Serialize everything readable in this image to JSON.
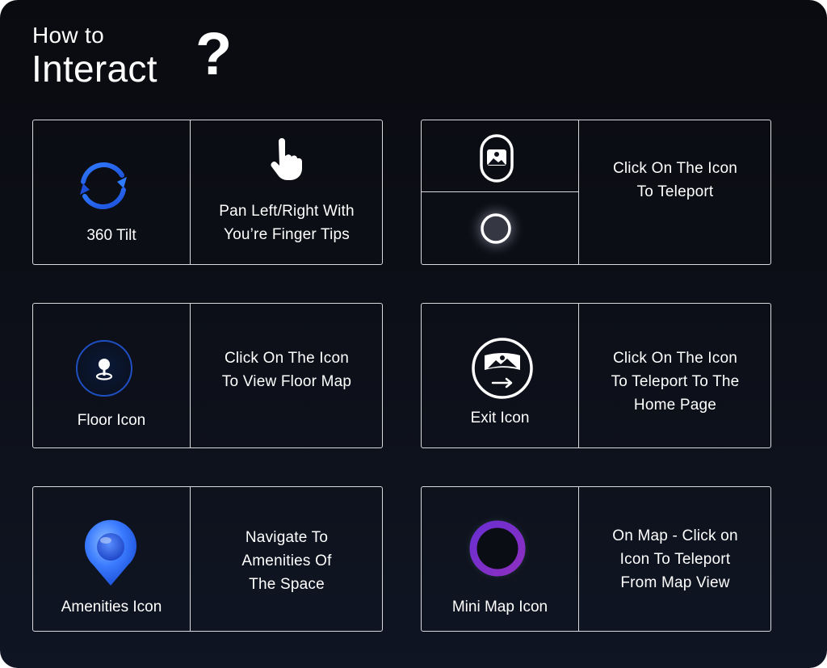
{
  "header": {
    "line1": "How to",
    "line2": "Interact",
    "mark": "?"
  },
  "cards": [
    {
      "label": "360 Tilt",
      "icon": "rotate-360-icon",
      "desc": [
        "Pan Left/Right With",
        "You’re Finger Tips"
      ],
      "desc_icon": "pointing-hand-icon"
    },
    {
      "icon_top": "teleport-capsule-icon",
      "icon_bottom": "teleport-circle-icon",
      "desc": [
        "Click On The Icon",
        "To Teleport"
      ]
    },
    {
      "label": "Floor Icon",
      "icon": "floor-pin-icon",
      "desc": [
        "Click On The Icon",
        "To View Floor Map"
      ]
    },
    {
      "label": "Exit Icon",
      "icon": "exit-panorama-icon",
      "desc": [
        "Click On The Icon",
        "To Teleport To The",
        "Home Page"
      ]
    },
    {
      "label": "Amenities Icon",
      "icon": "amenities-pin-icon",
      "desc": [
        "Navigate To",
        "Amenities Of",
        "The Space"
      ]
    },
    {
      "label": "Mini Map Icon",
      "icon": "mini-map-ring-icon",
      "desc": [
        "On Map - Click on",
        "Icon To Teleport",
        "From Map View"
      ]
    }
  ],
  "colors": {
    "background": "#0d1019",
    "border": "#d9d9de",
    "accent_blue": "#2f7bff",
    "accent_purple": "#7a2cc9"
  }
}
